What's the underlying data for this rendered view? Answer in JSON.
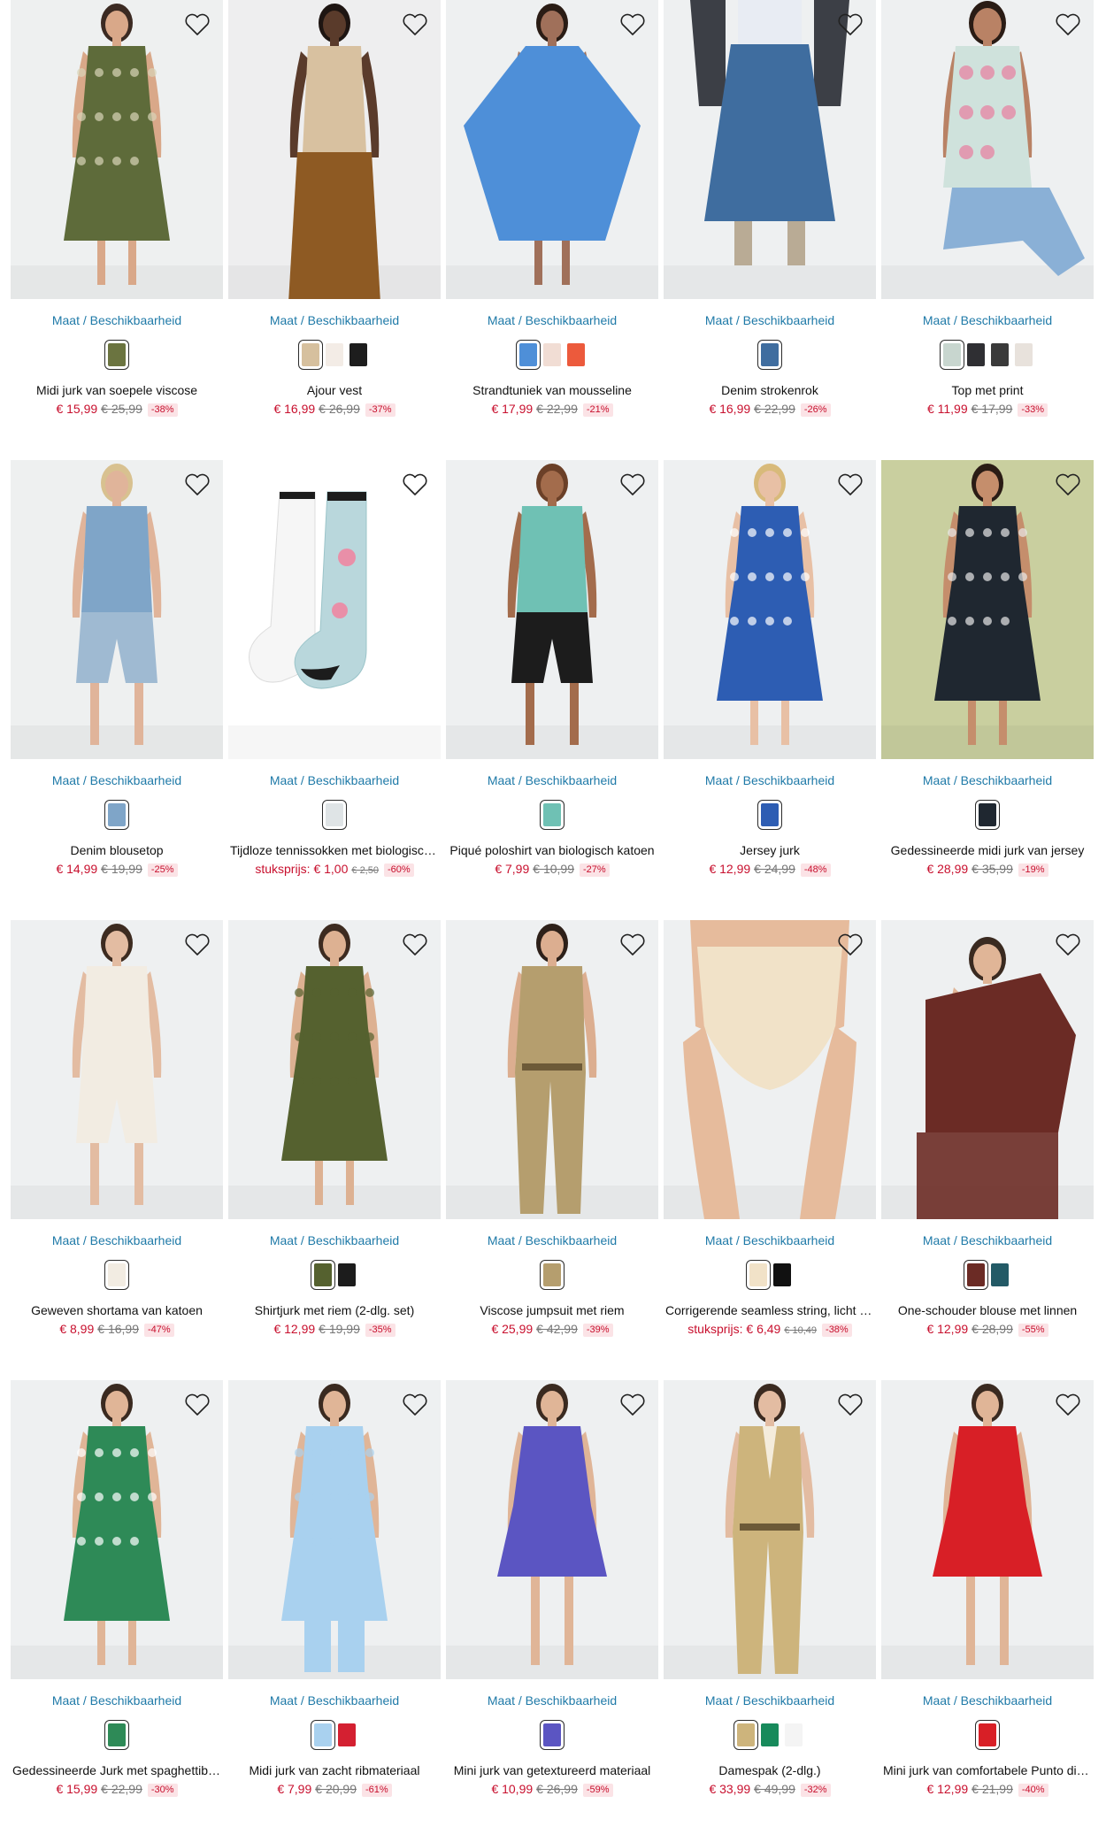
{
  "size_link_label": "Maat / Beschikbaarheid",
  "products": [
    {
      "title": "Midi jurk van soepele viscose",
      "unit": "",
      "price": "€ 15,99",
      "old": "€ 25,99",
      "discount": "-38%",
      "bg": "#eef0f0",
      "skin": "#d9a889",
      "hair": "#3b2a22",
      "garment": "#5e6b3a",
      "garment2": "#d9d4b8",
      "style": "dress",
      "swatches": [
        "#6b7440"
      ]
    },
    {
      "title": "Ajour vest",
      "unit": "",
      "price": "€ 16,99",
      "old": "€ 26,99",
      "discount": "-37%",
      "bg": "#eeeeef",
      "skin": "#5a3b2b",
      "hair": "#1e1512",
      "garment": "#d8c1a0",
      "garment2": "#8e5a23",
      "style": "top-pants",
      "swatches": [
        "#d6c09e",
        "#f3ece6",
        "#1d1d1d"
      ]
    },
    {
      "title": "Strandtuniek van mousseline",
      "unit": "",
      "price": "€ 17,99",
      "old": "€ 22,99",
      "discount": "-21%",
      "bg": "#eef0f1",
      "skin": "#a0705a",
      "hair": "#2a1c15",
      "garment": "#4e8fd8",
      "garment2": "#4e8fd8",
      "style": "kaftan",
      "swatches": [
        "#4e8fd8",
        "#f1ddd4",
        "#ec5a3c"
      ]
    },
    {
      "title": "Denim strokenrok",
      "unit": "",
      "price": "€ 16,99",
      "old": "€ 22,99",
      "discount": "-26%",
      "bg": "#eef0f1",
      "skin": "#e2b9a0",
      "hair": "#444",
      "garment": "#3f6d9f",
      "garment2": "#3c3f46",
      "style": "skirt",
      "swatches": [
        "#3f6d9f"
      ]
    },
    {
      "title": "Top met print",
      "unit": "",
      "price": "€ 11,99",
      "old": "€ 17,99",
      "discount": "-33%",
      "bg": "#eef0f1",
      "skin": "#b98265",
      "hair": "#2a1c15",
      "garment": "#cfe2dc",
      "garment2": "#8ab0d6",
      "style": "top-jeans",
      "swatches": [
        "#c8d6cf",
        "#2f2f33",
        "#3a3a3a",
        "#e8e2dc"
      ]
    },
    {
      "title": "Denim blousetop",
      "unit": "",
      "price": "€ 14,99",
      "old": "€ 19,99",
      "discount": "-25%",
      "bg": "#eef0f0",
      "skin": "#e0b49a",
      "hair": "#d8c190",
      "garment": "#7fa5c8",
      "garment2": "#9fbad2",
      "style": "top-shorts",
      "swatches": [
        "#7fa5c8"
      ]
    },
    {
      "title": "Tijdloze tennissokken met biologisch katoen",
      "unit": "",
      "price": "€ 1,00",
      "old": "€ 2,50",
      "discount": "-60%",
      "unitlabel": "stuksprijs:",
      "bg": "#ffffff",
      "skin": "#ffffff",
      "hair": "#ffffff",
      "garment": "#f5f5f5",
      "garment2": "#b9d7dc",
      "style": "socks",
      "swatches": [
        "#dfe4e6"
      ]
    },
    {
      "title": "Piqué poloshirt van biologisch katoen",
      "unit": "",
      "price": "€ 7,99",
      "old": "€ 10,99",
      "discount": "-27%",
      "bg": "#eef0f1",
      "skin": "#a36c4c",
      "hair": "#6b4028",
      "garment": "#6fc1b4",
      "garment2": "#1c1c1c",
      "style": "top-shorts",
      "swatches": [
        "#6fc1b4"
      ]
    },
    {
      "title": "Jersey jurk",
      "unit": "",
      "price": "€ 12,99",
      "old": "€ 24,99",
      "discount": "-48%",
      "bg": "#eef0f1",
      "skin": "#e8c0a5",
      "hair": "#d8ba7a",
      "garment": "#2d5db3",
      "garment2": "#ffffff",
      "style": "dress",
      "swatches": [
        "#2d5db3"
      ]
    },
    {
      "title": "Gedessineerde midi jurk van jersey",
      "unit": "",
      "price": "€ 28,99",
      "old": "€ 35,99",
      "discount": "-19%",
      "bg": "#c9cf9f",
      "skin": "#c58e6c",
      "hair": "#2a1c15",
      "garment": "#1f2730",
      "garment2": "#e8e8e8",
      "style": "dress",
      "swatches": [
        "#1f2730"
      ]
    },
    {
      "title": "Geweven shortama van katoen",
      "unit": "",
      "price": "€ 8,99",
      "old": "€ 16,99",
      "discount": "-47%",
      "bg": "#eef0f1",
      "skin": "#e3bca2",
      "hair": "#3d2b20",
      "garment": "#f2ece2",
      "garment2": "#f2ece2",
      "style": "top-shorts",
      "swatches": [
        "#f2ece2"
      ]
    },
    {
      "title": "Shirtjurk met riem (2-dlg. set)",
      "unit": "",
      "price": "€ 12,99",
      "old": "€ 19,99",
      "discount": "-35%",
      "bg": "#eef0f1",
      "skin": "#ddb192",
      "hair": "#3d2b20",
      "garment": "#55612f",
      "garment2": "#55612f",
      "style": "dress",
      "swatches": [
        "#55612f",
        "#1c1c1c"
      ]
    },
    {
      "title": "Viscose jumpsuit met riem",
      "unit": "",
      "price": "€ 25,99",
      "old": "€ 42,99",
      "discount": "-39%",
      "bg": "#eef0f1",
      "skin": "#dcae90",
      "hair": "#2d2019",
      "garment": "#b59e6e",
      "garment2": "#b59e6e",
      "style": "jumpsuit",
      "swatches": [
        "#b59e6e"
      ]
    },
    {
      "title": "Corrigerende seamless string, licht corrigerend",
      "unit": "",
      "price": "€ 6,49",
      "old": "€ 10,49",
      "discount": "-38%",
      "unitlabel": "stuksprijs:",
      "bg": "#eef0f1",
      "skin": "#e6bb9c",
      "hair": "#e6bb9c",
      "garment": "#f1e2c8",
      "garment2": "#f1e2c8",
      "style": "shapewear",
      "swatches": [
        "#f1e2c8",
        "#111111"
      ]
    },
    {
      "title": "One-schouder blouse met linnen",
      "unit": "",
      "price": "€ 12,99",
      "old": "€ 28,99",
      "discount": "-55%",
      "bg": "#eef0f1",
      "skin": "#e0b597",
      "hair": "#3a2a20",
      "garment": "#6b2b25",
      "garment2": "#6b2b25",
      "style": "blouse",
      "swatches": [
        "#6b2b25",
        "#235a66"
      ]
    },
    {
      "title": "Gedessineerde Jurk met spaghettibandjes",
      "unit": "",
      "price": "€ 15,99",
      "old": "€ 22,99",
      "discount": "-30%",
      "bg": "#eef0f1",
      "skin": "#e0b597",
      "hair": "#3a2a20",
      "garment": "#2e8a57",
      "garment2": "#ffffff",
      "style": "dress",
      "swatches": [
        "#2e8a57"
      ]
    },
    {
      "title": "Midi jurk van zacht ribmateriaal",
      "unit": "",
      "price": "€ 7,99",
      "old": "€ 20,99",
      "discount": "-61%",
      "bg": "#eef0f1",
      "skin": "#e0b597",
      "hair": "#3a2a20",
      "garment": "#a9d1ef",
      "garment2": "#a9d1ef",
      "style": "dress-pants",
      "swatches": [
        "#a9d1ef",
        "#d42031"
      ]
    },
    {
      "title": "Mini jurk van getextureerd materiaal",
      "unit": "",
      "price": "€ 10,99",
      "old": "€ 26,99",
      "discount": "-59%",
      "bg": "#eef0f1",
      "skin": "#e0b597",
      "hair": "#3a2a20",
      "garment": "#5b55c2",
      "garment2": "#5b55c2",
      "style": "mini",
      "swatches": [
        "#5b55c2"
      ]
    },
    {
      "title": "Damespak (2-dlg.)",
      "unit": "",
      "price": "€ 33,99",
      "old": "€ 49,99",
      "discount": "-32%",
      "bg": "#eef0f1",
      "skin": "#e3bca2",
      "hair": "#3a2a20",
      "garment": "#cdb47c",
      "garment2": "#cdb47c",
      "style": "suit",
      "swatches": [
        "#cdb47c",
        "#178a5b",
        "#f4f4f4"
      ]
    },
    {
      "title": "Mini jurk van comfortabele Punto di Roma",
      "unit": "",
      "price": "€ 12,99",
      "old": "€ 21,99",
      "discount": "-40%",
      "bg": "#eef0f1",
      "skin": "#e0b597",
      "hair": "#3a2a20",
      "garment": "#d81f26",
      "garment2": "#d81f26",
      "style": "mini",
      "swatches": [
        "#d81f26"
      ]
    }
  ]
}
